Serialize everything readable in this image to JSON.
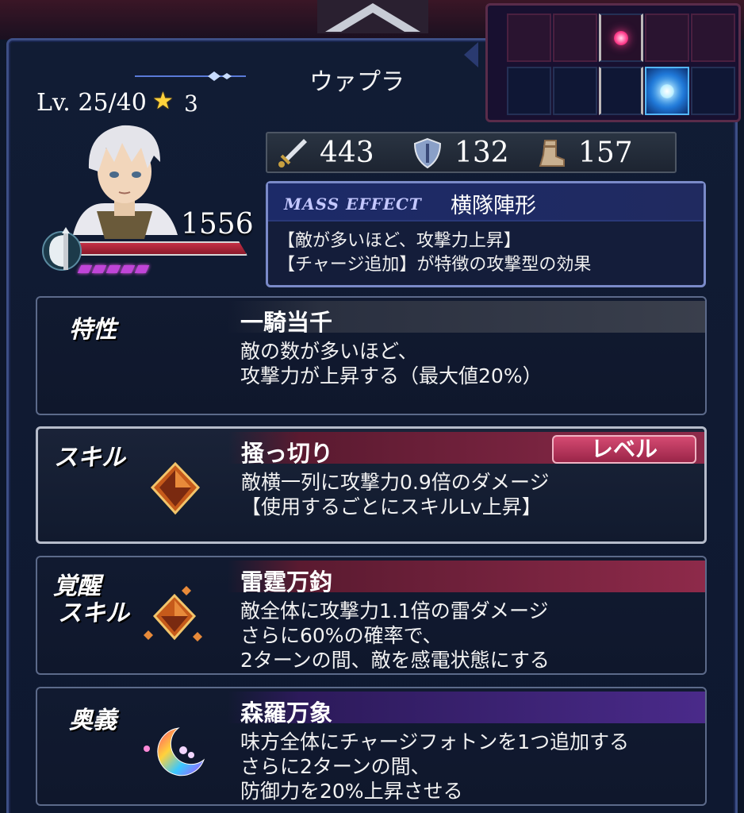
{
  "character": {
    "name": "ウァプラ",
    "level_label": "Lv. 25/40",
    "rarity": "3",
    "hp": "1556",
    "charge_pips": 5
  },
  "stats": {
    "attack": "443",
    "defense": "132",
    "speed": "157"
  },
  "mass_effect": {
    "tag": "MASS EFFECT",
    "title": "横隊陣形",
    "desc_line1": "【敵が多いほど、攻撃力上昇】",
    "desc_line2": "【チャージ追加】が特徴の攻撃型の効果"
  },
  "trait": {
    "label": "特性",
    "title": "一騎当千",
    "desc_line1": "敵の数が多いほど、",
    "desc_line2": "攻撃力が上昇する（最大値20%）"
  },
  "skill": {
    "label": "スキル",
    "title": "掻っ切り",
    "level_button": "レベル",
    "desc_line1": "敵横一列に攻撃力0.9倍のダメージ",
    "desc_line2": "【使用するごとにスキルLv上昇】"
  },
  "awakened_skill": {
    "label_line1": "覚醒",
    "label_line2": "スキル",
    "title": "雷霆万鈞",
    "desc_line1": "敵全体に攻撃力1.1倍の雷ダメージ",
    "desc_line2": "さらに60%の確率で、",
    "desc_line3": "2ターンの間、敵を感電状態にする"
  },
  "ultimate": {
    "label": "奥義",
    "title": "森羅万象",
    "desc_line1": "味方全体にチャージフォトンを1つ追加する",
    "desc_line2": "さらに2ターンの間、",
    "desc_line3": "防御力を20%上昇させる"
  },
  "formation": {
    "rows": 2,
    "cols": 5,
    "red_marker": {
      "row": 1,
      "col": 3
    },
    "blue_marker": {
      "row": 2,
      "col": 4
    }
  },
  "colors": {
    "accent_red": "#8e2a4a",
    "accent_purple": "#4a2a8a",
    "hp_bar": "#c43045",
    "star": "#ffd23c"
  },
  "icons": {
    "attack": "sword-icon",
    "defense": "shield-icon",
    "speed": "boot-icon",
    "weapon": "axe-icon"
  }
}
